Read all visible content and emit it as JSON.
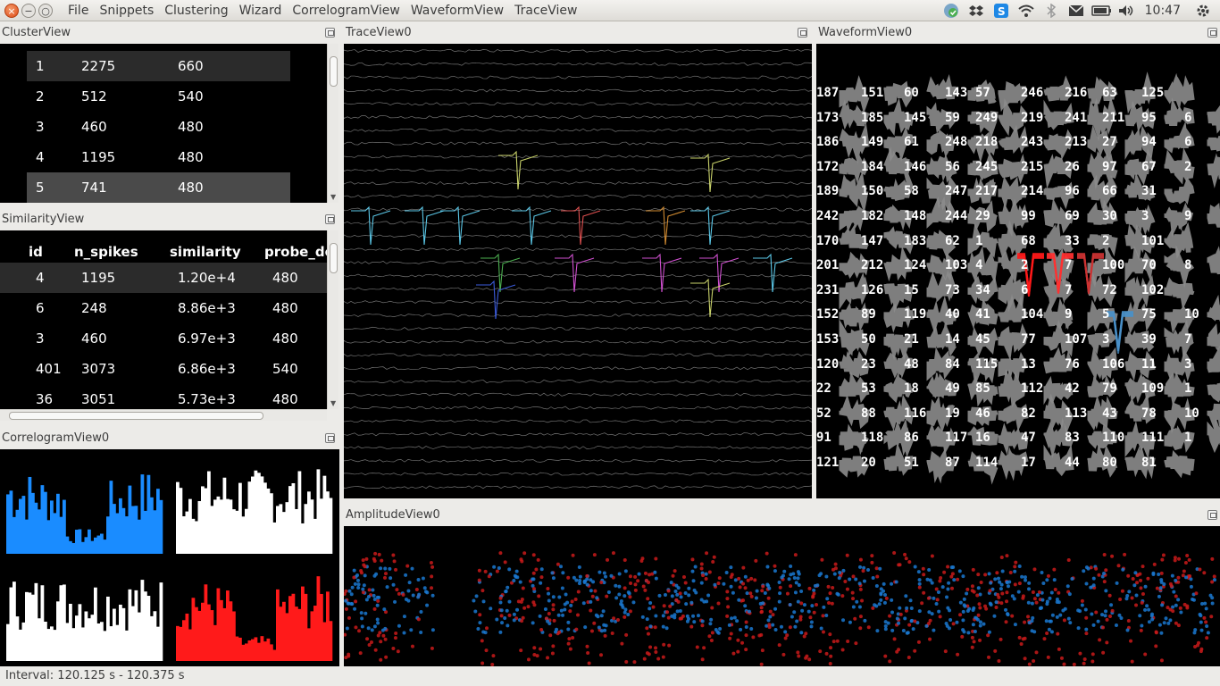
{
  "window": {
    "close": "×",
    "minimize": "−",
    "maximize": "○"
  },
  "menu": [
    "File",
    "Snippets",
    "Clustering",
    "Wizard",
    "CorrelogramView",
    "WaveformView",
    "TraceView"
  ],
  "tray": {
    "icons": [
      "update-shield-icon",
      "dropbox-icon",
      "skype-icon",
      "wifi-icon",
      "bluetooth-icon",
      "mail-icon",
      "battery-icon",
      "volume-icon",
      "settings-gear-icon"
    ],
    "time": "10:47"
  },
  "cluster_view": {
    "title": "ClusterView",
    "rows": [
      {
        "id": "1",
        "n_spikes": "2275",
        "probe": "660",
        "state": "selected"
      },
      {
        "id": "2",
        "n_spikes": "512",
        "probe": "540",
        "state": ""
      },
      {
        "id": "3",
        "n_spikes": "460",
        "probe": "480",
        "state": ""
      },
      {
        "id": "4",
        "n_spikes": "1195",
        "probe": "480",
        "state": ""
      },
      {
        "id": "5",
        "n_spikes": "741",
        "probe": "480",
        "state": "highlight"
      }
    ]
  },
  "similarity_view": {
    "title": "SimilarityView",
    "columns": [
      "id",
      "n_spikes",
      "similarity",
      "probe_de"
    ],
    "rows": [
      {
        "id": "4",
        "n_spikes": "1195",
        "similarity": "1.20e+4",
        "probe": "480",
        "state": "selected"
      },
      {
        "id": "6",
        "n_spikes": "248",
        "similarity": "8.86e+3",
        "probe": "480",
        "state": ""
      },
      {
        "id": "3",
        "n_spikes": "460",
        "similarity": "6.97e+3",
        "probe": "480",
        "state": ""
      },
      {
        "id": "401",
        "n_spikes": "3073",
        "similarity": "6.86e+3",
        "probe": "540",
        "state": ""
      },
      {
        "id": "36",
        "n_spikes": "3051",
        "similarity": "5.73e+3",
        "probe": "480",
        "state": ""
      }
    ]
  },
  "correlogram_view": {
    "title": "CorrelogramView0"
  },
  "trace_view": {
    "title": "TraceView0"
  },
  "waveform_view": {
    "title": "WaveformView0",
    "grid": [
      [
        "187",
        "151",
        "60",
        "143",
        "57",
        "246",
        "216",
        "63",
        "125"
      ],
      [
        "173",
        "185",
        "145",
        "59",
        "249",
        "219",
        "241",
        "211",
        "95",
        "6"
      ],
      [
        "186",
        "149",
        "61",
        "248",
        "218",
        "243",
        "213",
        "27",
        "94",
        "6"
      ],
      [
        "172",
        "184",
        "146",
        "56",
        "245",
        "215",
        "26",
        "97",
        "67",
        "2"
      ],
      [
        "189",
        "150",
        "58",
        "247",
        "217",
        "214",
        "96",
        "66",
        "31"
      ],
      [
        "242",
        "182",
        "148",
        "244",
        "29",
        "99",
        "69",
        "30",
        "3",
        "9"
      ],
      [
        "170",
        "147",
        "183",
        "62",
        "1",
        "68",
        "33",
        "2",
        "101"
      ],
      [
        "201",
        "212",
        "124",
        "103",
        "4",
        "2",
        "7",
        "100",
        "70",
        "8"
      ],
      [
        "231",
        "126",
        "15",
        "73",
        "34",
        "6",
        "7",
        "72",
        "102"
      ],
      [
        "152",
        "89",
        "119",
        "40",
        "41",
        "104",
        "9",
        "5",
        "75",
        "10"
      ],
      [
        "153",
        "50",
        "21",
        "14",
        "45",
        "77",
        "107",
        "3",
        "39",
        "7"
      ],
      [
        "120",
        "23",
        "48",
        "84",
        "115",
        "13",
        "76",
        "106",
        "11",
        "3"
      ],
      [
        "22",
        "53",
        "18",
        "49",
        "85",
        "112",
        "42",
        "79",
        "109",
        "1"
      ],
      [
        "52",
        "88",
        "116",
        "19",
        "46",
        "82",
        "113",
        "43",
        "78",
        "10"
      ],
      [
        "91",
        "118",
        "86",
        "117",
        "16",
        "47",
        "83",
        "110",
        "111",
        "1"
      ],
      [
        "121",
        "20",
        "51",
        "87",
        "114",
        "17",
        "44",
        "80",
        "81"
      ]
    ]
  },
  "amplitude_view": {
    "title": "AmplitudeView0"
  },
  "status": {
    "text": "Interval: 120.125 s - 120.375 s"
  },
  "colors": {
    "blue": "#1a8cff",
    "red": "#ff1a1a",
    "white": "#ffffff",
    "selected_row": "#2b2b2b",
    "highlight_row": "#4a4a4a"
  }
}
